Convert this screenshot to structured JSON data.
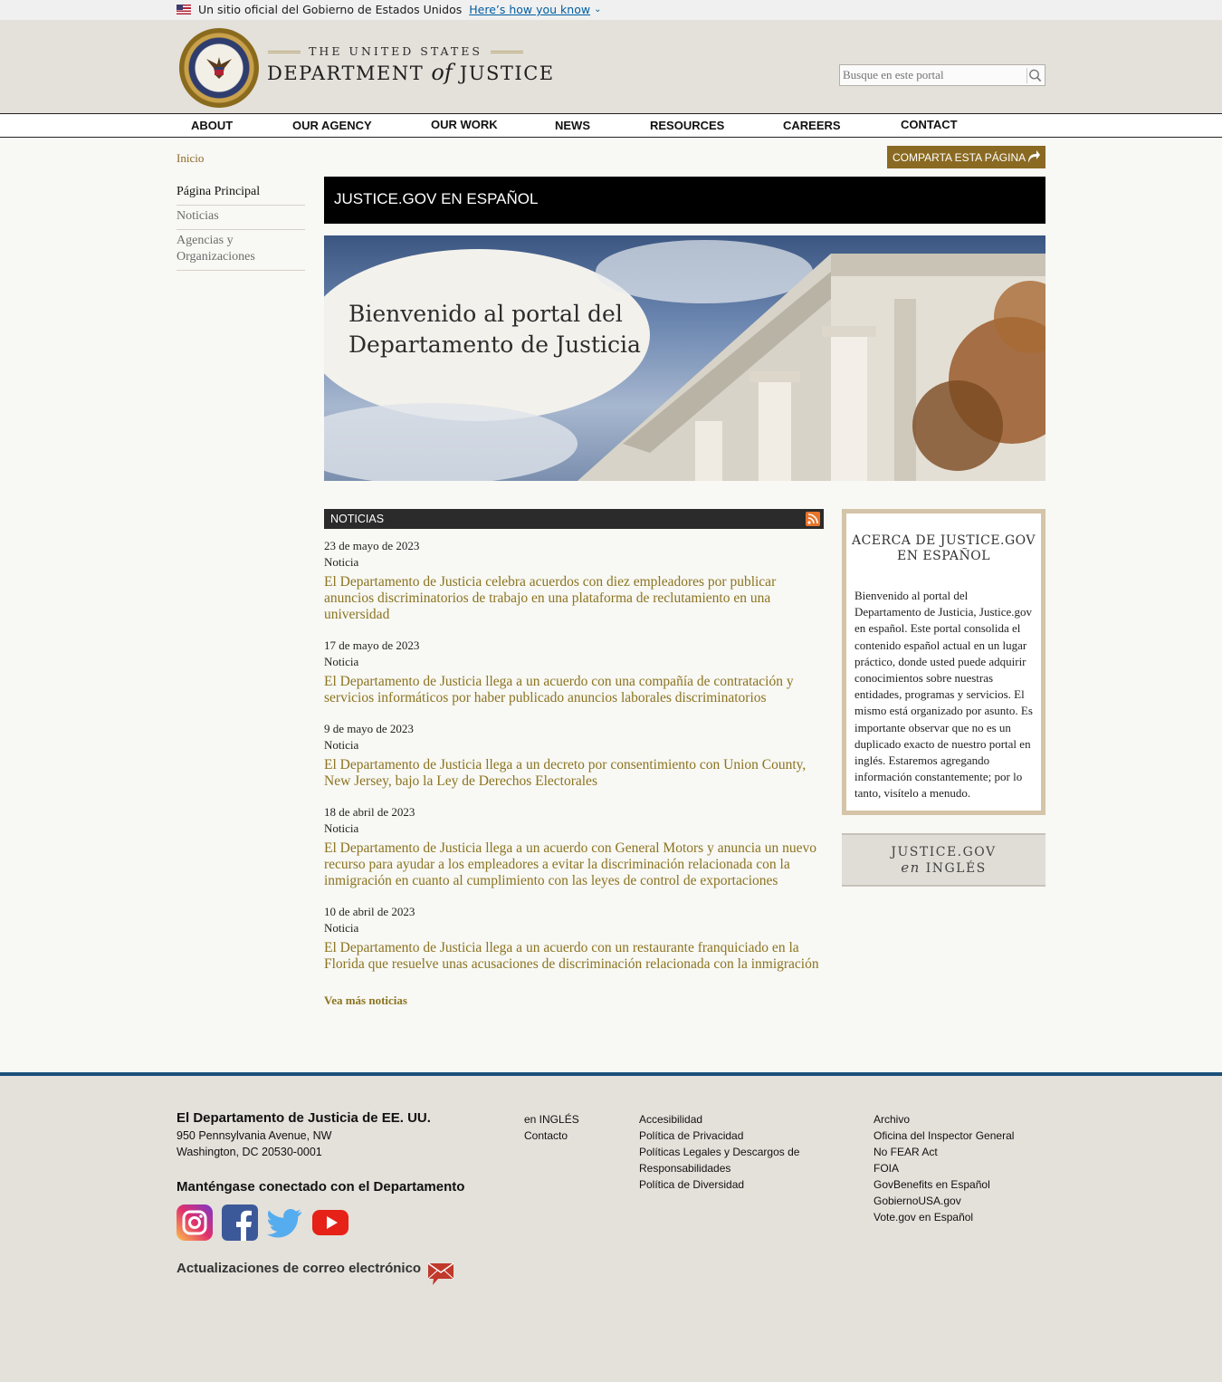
{
  "gov_banner": {
    "text": "Un sitio oficial del Gobierno de Estados Unidos",
    "link": "Here’s how you know"
  },
  "header": {
    "logo_top": "THE UNITED STATES",
    "logo_main_left": "DEPARTMENT",
    "logo_main_of": "of",
    "logo_main_right": "JUSTICE",
    "search_placeholder": "Busque en este portal"
  },
  "nav": [
    "ABOUT",
    "OUR AGENCY",
    "OUR WORK",
    "NEWS",
    "RESOURCES",
    "CAREERS",
    "CONTACT"
  ],
  "breadcrumb": "Inicio",
  "share_label": "COMPARTA ESTA PÁGINA",
  "sidebar": [
    {
      "label": "Página Principal",
      "active": true
    },
    {
      "label": "Noticias",
      "active": false
    },
    {
      "label": "Agencias y Organizaciones",
      "active": false
    }
  ],
  "page_title": "JUSTICE.GOV EN ESPAÑOL",
  "hero": {
    "line1": "Bienvenido al portal del",
    "line2": "Departamento de Justicia"
  },
  "news": {
    "heading": "NOTICIAS",
    "items": [
      {
        "date": "23 de mayo de 2023",
        "type": "Noticia",
        "title": "El Departamento de Justicia celebra acuerdos con diez empleadores por publicar anuncios discriminatorios de trabajo en una plataforma de reclutamiento en una universidad"
      },
      {
        "date": "17 de mayo de 2023",
        "type": "Noticia",
        "title": "El Departamento de Justicia llega a un acuerdo con una compañía de contratación y servicios informáticos por haber publicado anuncios laborales discriminatorios"
      },
      {
        "date": "9 de mayo de 2023",
        "type": "Noticia",
        "title": "El Departamento de Justicia llega a un decreto por consentimiento con Union County, New Jersey, bajo la Ley de Derechos Electorales"
      },
      {
        "date": "18 de abril de 2023",
        "type": "Noticia",
        "title": "El Departamento de Justicia llega a un acuerdo con General Motors y anuncia un nuevo recurso para ayudar a los empleadores a evitar la discriminación relacionada con la inmigración en cuanto al cumplimiento con las leyes de control de exportaciones"
      },
      {
        "date": "10 de abril de 2023",
        "type": "Noticia",
        "title": "El Departamento de Justicia llega a un acuerdo con un restaurante franquiciado en la Florida que resuelve unas acusaciones de discriminación relacionada con la inmigración"
      }
    ],
    "more": "Vea más noticias"
  },
  "about": {
    "heading_line1": "ACERCA DE JUSTICE.GOV",
    "heading_line2": "EN ESPAÑOL",
    "body": "Bienvenido al portal del Departamento de Justicia, Justice.gov en español. Este portal consolida el contenido español actual en un lugar práctico, donde usted puede adquirir conocimientos sobre nuestras entidades, programas y servicios. El mismo está organizado por asunto. Es importante observar que no es un duplicado exacto de nuestro portal en inglés. Estaremos agregando información constantemente; por lo tanto, visítelo a menudo."
  },
  "ingles_box": {
    "line1": "JUSTICE.GOV",
    "line2_en": "en",
    "line2": "INGLÉS"
  },
  "footer": {
    "org": "El Departamento de Justicia de EE. UU.",
    "address1": "950 Pennsylvania Avenue, NW",
    "address2": "Washington, DC 20530-0001",
    "connect": "Manténgase conectado con el Departamento",
    "email_updates": "Actualizaciones de correo electrónico",
    "col1": [
      "en INGLÉS",
      "Contacto"
    ],
    "col2": [
      "Accesibilidad",
      "Política de Privacidad",
      "Políticas Legales y Descargos de Responsabilidades",
      "Política de Diversidad"
    ],
    "col3": [
      "Archivo",
      "Oficina del Inspector General",
      "No FEAR Act",
      "FOIA",
      "GovBenefits en Español",
      "GobiernoUSA.gov",
      "Vote.gov en Español"
    ],
    "social": [
      "instagram-icon",
      "facebook-icon",
      "twitter-icon",
      "youtube-icon"
    ]
  },
  "colors": {
    "gold": "#8b7420",
    "share_bg": "#8a6a22",
    "footer_rule": "#1b4f7a",
    "header_bg": "#e4e0da"
  }
}
